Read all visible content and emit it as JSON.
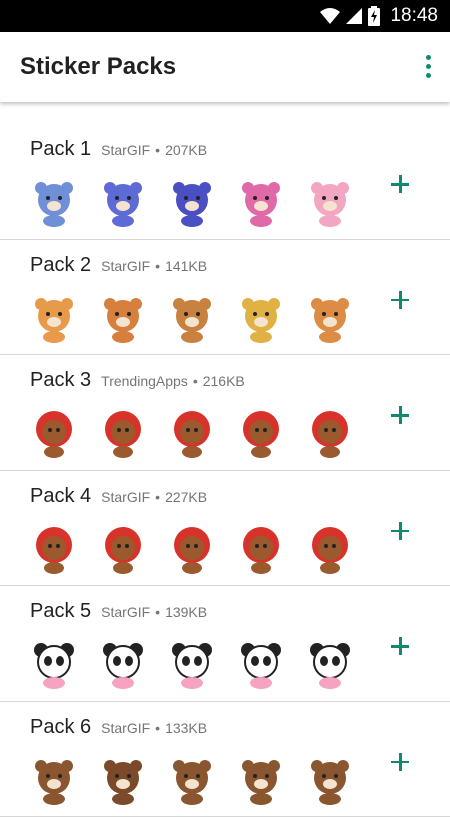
{
  "status_bar": {
    "time": "18:48",
    "icons": [
      "wifi-icon",
      "signal-icon",
      "battery-charging-icon"
    ]
  },
  "app_bar": {
    "title": "Sticker Packs",
    "menu_icon": "more-vert-icon",
    "accent_color": "#0f8a6e"
  },
  "packs": [
    {
      "name": "Pack 1",
      "publisher": "StarGIF",
      "separator": "•",
      "size": "207KB",
      "stickers": [
        {
          "icon": "blue-bear-icon",
          "color": "#6f8fd6"
        },
        {
          "icon": "teddy-heart-icon",
          "color": "#5c6bd6"
        },
        {
          "icon": "sloth-badge-icon",
          "color": "#4b4fc4"
        },
        {
          "icon": "pink-unicorn-icon",
          "color": "#e06aa8"
        },
        {
          "icon": "pink-cat-icon",
          "color": "#f3a6c1"
        }
      ]
    },
    {
      "name": "Pack 2",
      "publisher": "StarGIF",
      "separator": "•",
      "size": "141KB",
      "stickers": [
        {
          "icon": "bear-beer-icon",
          "color": "#e79a4a"
        },
        {
          "icon": "bear-tophat-icon",
          "color": "#d77f3d"
        },
        {
          "icon": "bear-crown-icon",
          "color": "#c8813e"
        },
        {
          "icon": "bear-beach-icon",
          "color": "#e0b143"
        },
        {
          "icon": "bear-reading-icon",
          "color": "#dc8c45"
        }
      ]
    },
    {
      "name": "Pack 3",
      "publisher": "TrendingApps",
      "separator": "•",
      "size": "216KB",
      "stickers": [
        {
          "icon": "red-hood-bear-icon",
          "color": "#d8332a"
        },
        {
          "icon": "red-hood-bear-icon",
          "color": "#d8332a"
        },
        {
          "icon": "red-hood-bear-icon",
          "color": "#d8332a"
        },
        {
          "icon": "red-hood-bear-icon",
          "color": "#d8332a"
        },
        {
          "icon": "red-hood-bear-icon",
          "color": "#d8332a"
        }
      ]
    },
    {
      "name": "Pack 4",
      "publisher": "StarGIF",
      "separator": "•",
      "size": "227KB",
      "stickers": [
        {
          "icon": "bear-no-sign-icon",
          "color": "#d8332a"
        },
        {
          "icon": "bear-dancing-icon",
          "color": "#d8332a"
        },
        {
          "icon": "bear-peace-icon",
          "color": "#d8332a"
        },
        {
          "icon": "bear-wave-icon",
          "color": "#d8332a"
        },
        {
          "icon": "bear-jump-icon",
          "color": "#d8332a"
        }
      ]
    },
    {
      "name": "Pack 5",
      "publisher": "StarGIF",
      "separator": "•",
      "size": "139KB",
      "stickers": [
        {
          "icon": "panda-icon",
          "color": "#2b2b2b"
        },
        {
          "icon": "panda-icon",
          "color": "#2b2b2b"
        },
        {
          "icon": "panda-icon",
          "color": "#2b2b2b"
        },
        {
          "icon": "panda-icon",
          "color": "#2b2b2b"
        },
        {
          "icon": "panda-crying-icon",
          "color": "#2b2b2b"
        }
      ]
    },
    {
      "name": "Pack 6",
      "publisher": "StarGIF",
      "separator": "•",
      "size": "133KB",
      "stickers": [
        {
          "icon": "brown-bear-love-icon",
          "color": "#8a5630"
        },
        {
          "icon": "brown-bear-laugh-icon",
          "color": "#7a4a2a"
        },
        {
          "icon": "brown-bear-sleepy-icon",
          "color": "#8a5630"
        },
        {
          "icon": "brown-bear-shy-icon",
          "color": "#8a5630"
        },
        {
          "icon": "brown-bear-happy-icon",
          "color": "#8a5630"
        }
      ]
    }
  ]
}
